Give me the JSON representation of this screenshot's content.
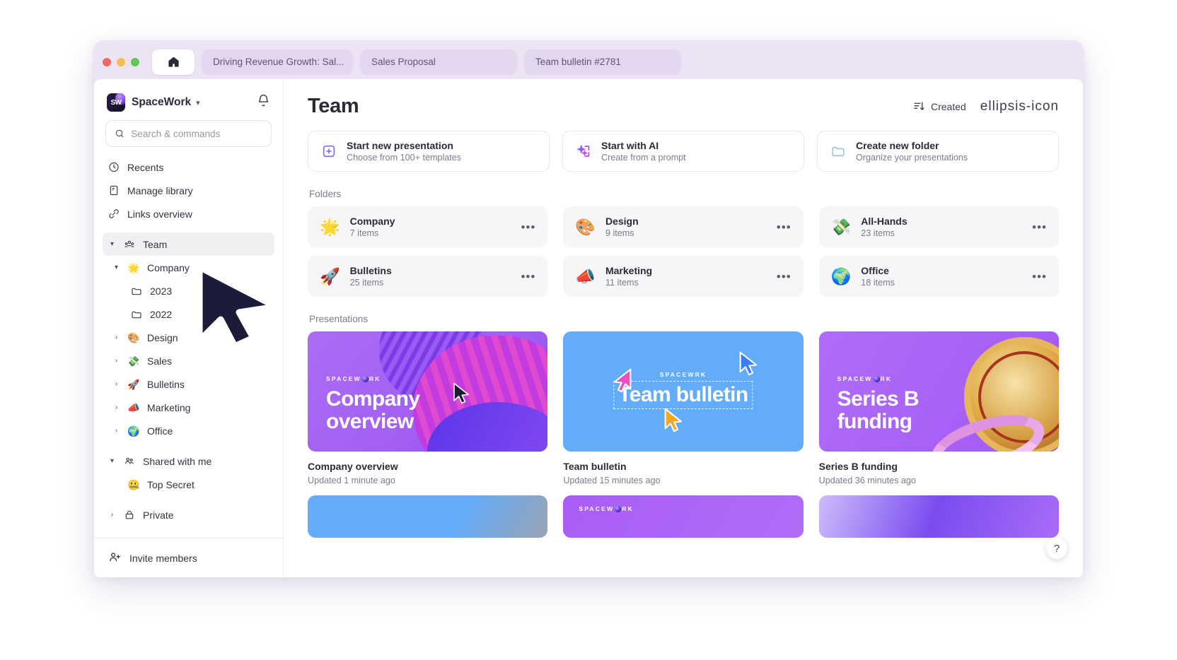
{
  "window": {
    "home_tab_icon": "home-icon",
    "tabs": [
      {
        "label": "Driving Revenue Growth: Sal..."
      },
      {
        "label": "Sales Proposal"
      },
      {
        "label": "Team bulletin #2781"
      }
    ]
  },
  "sidebar": {
    "workspace": "SpaceWork",
    "workspace_logo_text": "SW",
    "chevron": "▾",
    "bell_icon": "bell-icon",
    "search": {
      "placeholder": "Search & commands",
      "value": "",
      "icon": "search-icon"
    },
    "nav": [
      {
        "label": "Recents",
        "icon": "clock-icon",
        "type": "link"
      },
      {
        "label": "Manage library",
        "icon": "library-icon",
        "type": "link"
      },
      {
        "label": "Links overview",
        "icon": "link-icon",
        "type": "link"
      }
    ],
    "tree": [
      {
        "label": "Team",
        "icon": "people-icon",
        "caret": "▾",
        "indent": 0,
        "active": true
      },
      {
        "label": "Company",
        "emoji": "🌟",
        "caret": "▾",
        "indent": 1
      },
      {
        "label": "2023",
        "icon": "folder-icon",
        "caret": "",
        "indent": 2
      },
      {
        "label": "2022",
        "icon": "folder-icon",
        "caret": "",
        "indent": 2
      },
      {
        "label": "Design",
        "emoji": "🎨",
        "caret": "›",
        "indent": 1
      },
      {
        "label": "Sales",
        "emoji": "💸",
        "caret": "›",
        "indent": 1
      },
      {
        "label": "Bulletins",
        "emoji": "🚀",
        "caret": "›",
        "indent": 1
      },
      {
        "label": "Marketing",
        "emoji": "📣",
        "caret": "›",
        "indent": 1
      },
      {
        "label": "Office",
        "emoji": "🌍",
        "caret": "›",
        "indent": 1
      }
    ],
    "shared": {
      "label": "Shared with me",
      "icon": "people-shared-icon",
      "caret": "▾"
    },
    "shared_items": [
      {
        "label": "Top Secret",
        "emoji": "🤐"
      }
    ],
    "private": {
      "label": "Private",
      "icon": "lock-icon",
      "caret": "›"
    },
    "footer": {
      "label": "Invite members",
      "icon": "add-person-icon"
    }
  },
  "main": {
    "title": "Team",
    "sort": {
      "label": "Created",
      "icon": "sort-icon"
    },
    "more_icon": "ellipsis-icon",
    "actions": [
      {
        "title": "Start new presentation",
        "subtitle": "Choose from 100+ templates",
        "icon": "plus-square-icon"
      },
      {
        "title": "Start with AI",
        "subtitle": "Create from a prompt",
        "icon": "sparkle-icon"
      },
      {
        "title": "Create new folder",
        "subtitle": "Organize your presentations",
        "icon": "folder-icon"
      }
    ],
    "folders_label": "Folders",
    "folders": [
      {
        "name": "Company",
        "count": "7 items",
        "emoji": "🌟"
      },
      {
        "name": "Design",
        "count": "9 items",
        "emoji": "🎨"
      },
      {
        "name": "All-Hands",
        "count": "23 items",
        "emoji": "💸"
      },
      {
        "name": "Bulletins",
        "count": "25 items",
        "emoji": "🚀"
      },
      {
        "name": "Marketing",
        "count": "11 items",
        "emoji": "📣"
      },
      {
        "name": "Office",
        "count": "18 items",
        "emoji": "🌍"
      }
    ],
    "presentations_label": "Presentations",
    "presentations": [
      {
        "name": "Company overview",
        "updated": "Updated 1 minute ago",
        "thumb_brand": "SPACEW RK",
        "thumb_title_l1": "Company",
        "thumb_title_l2": "overview"
      },
      {
        "name": "Team bulletin",
        "updated": "Updated 15 minutes ago",
        "thumb_brand": "SPACEW RK",
        "thumb_title_l1": "Team bulletin",
        "thumb_title_l2": ""
      },
      {
        "name": "Series B funding",
        "updated": "Updated 36 minutes ago",
        "thumb_brand": "SPACEW RK",
        "thumb_title_l1": "Series B",
        "thumb_title_l2": "funding"
      }
    ],
    "help_label": "?"
  },
  "colors": {
    "accent": "#7b3ff2",
    "titlebar": "#ece4f5",
    "tab_bg": "#e2d7ef",
    "card_bg": "#f6f6f8",
    "thumb_purple": "#a45ff2",
    "thumb_blue": "#63acf9"
  }
}
